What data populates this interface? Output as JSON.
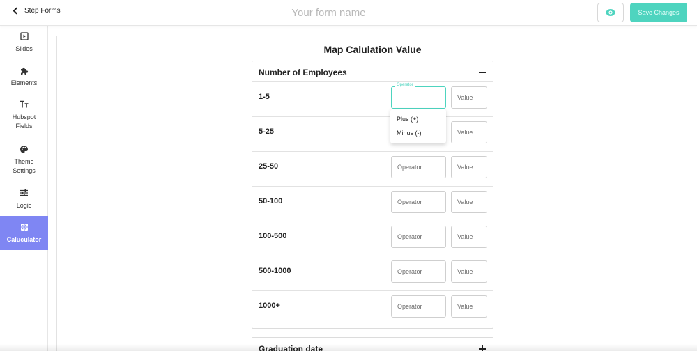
{
  "header": {
    "back_label": "Step Forms",
    "form_name_placeholder": "Your form name",
    "save_label": "Save Changes"
  },
  "sidebar": {
    "items": [
      {
        "label": "Slides",
        "icon": "play-square-icon"
      },
      {
        "label": "Elements",
        "icon": "puzzle-icon"
      },
      {
        "label": "Hubspot Fields",
        "icon": "text-size-icon"
      },
      {
        "label": "Theme Settings",
        "icon": "palette-icon"
      },
      {
        "label": "Logic",
        "icon": "sliders-icon"
      },
      {
        "label": "Caluculator",
        "icon": "calculator-icon",
        "active": true
      }
    ]
  },
  "main": {
    "title": "Map Calulation Value",
    "section": {
      "title": "Number of Employees",
      "rows": [
        {
          "label": "1-5"
        },
        {
          "label": "5-25"
        },
        {
          "label": "25-50"
        },
        {
          "label": "50-100"
        },
        {
          "label": "100-500"
        },
        {
          "label": "500-1000"
        },
        {
          "label": "1000+"
        }
      ],
      "operator_placeholder": "Operator",
      "value_placeholder": "Value",
      "focused_label": "Operator"
    },
    "dropdown": {
      "options": [
        "Plus (+)",
        "Minus (-)"
      ]
    },
    "section2": {
      "title": "Graduation date"
    }
  },
  "colors": {
    "accent": "#4ed4bf",
    "sidebar_active": "#7f86f3"
  }
}
